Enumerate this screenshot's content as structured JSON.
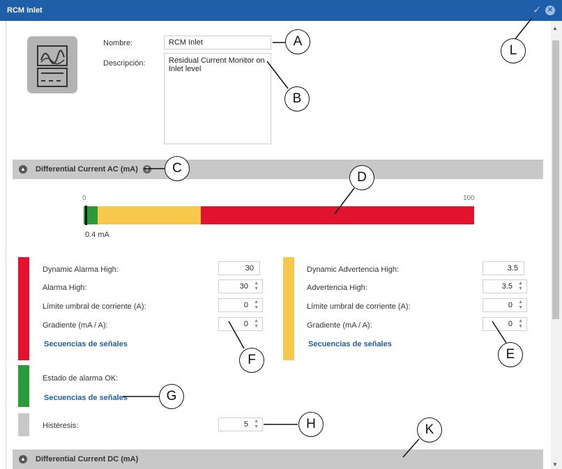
{
  "window": {
    "title": "RCM Inlet",
    "confirm_icon": "✓",
    "close_icon": "✕"
  },
  "logo": {
    "icon": "sine-wave-dc-icon"
  },
  "form": {
    "name_label": "Nombre:",
    "name_value": "RCM Inlet",
    "desc_label": "Descripción:",
    "desc_value": "Residual Current Monitor on Inlet level"
  },
  "section_ac": {
    "title": "Differential Current AC (mA)",
    "help": "?"
  },
  "section_dc": {
    "title": "Differential Current DC (mA)"
  },
  "gauge": {
    "min_label": "0",
    "max_label": "100",
    "current": "0.4 mA",
    "current_value": 0.4,
    "segments": [
      {
        "from": 0,
        "to": 3.5,
        "color": "#2a9a3a"
      },
      {
        "from": 3.5,
        "to": 30,
        "color": "#f7c84a"
      },
      {
        "from": 30,
        "to": 100,
        "color": "#e2132e"
      }
    ]
  },
  "alarm": {
    "color": "#e2132e",
    "dynamic_label": "Dynamic Alarma High:",
    "dynamic_value": "30",
    "high_label": "Alarma High:",
    "high_value": "30",
    "threshold_label": "Límite umbral de corriente (A):",
    "threshold_value": "0",
    "gradient_label": "Gradiente (mA / A):",
    "gradient_value": "0",
    "link": "Secuencias de señales"
  },
  "warning": {
    "color": "#f7c84a",
    "dynamic_label": "Dynamic Advertencia High:",
    "dynamic_value": "3.5",
    "high_label": "Advertencia High:",
    "high_value": "3.5",
    "threshold_label": "Límite umbral de corriente (A):",
    "threshold_value": "0",
    "gradient_label": "Gradiente (mA / A):",
    "gradient_value": "0",
    "link": "Secuencias de señales"
  },
  "ok": {
    "color": "#2a9a3a",
    "label": "Estado de alarma OK:",
    "link": "Secuencias de señales"
  },
  "hysteresis": {
    "color": "#c8c8c8",
    "label": "Histéresis:",
    "value": "5"
  },
  "callouts": {
    "A": "A",
    "B": "B",
    "C": "C",
    "D": "D",
    "E": "E",
    "F": "F",
    "G": "G",
    "H": "H",
    "K": "K",
    "L": "L"
  }
}
